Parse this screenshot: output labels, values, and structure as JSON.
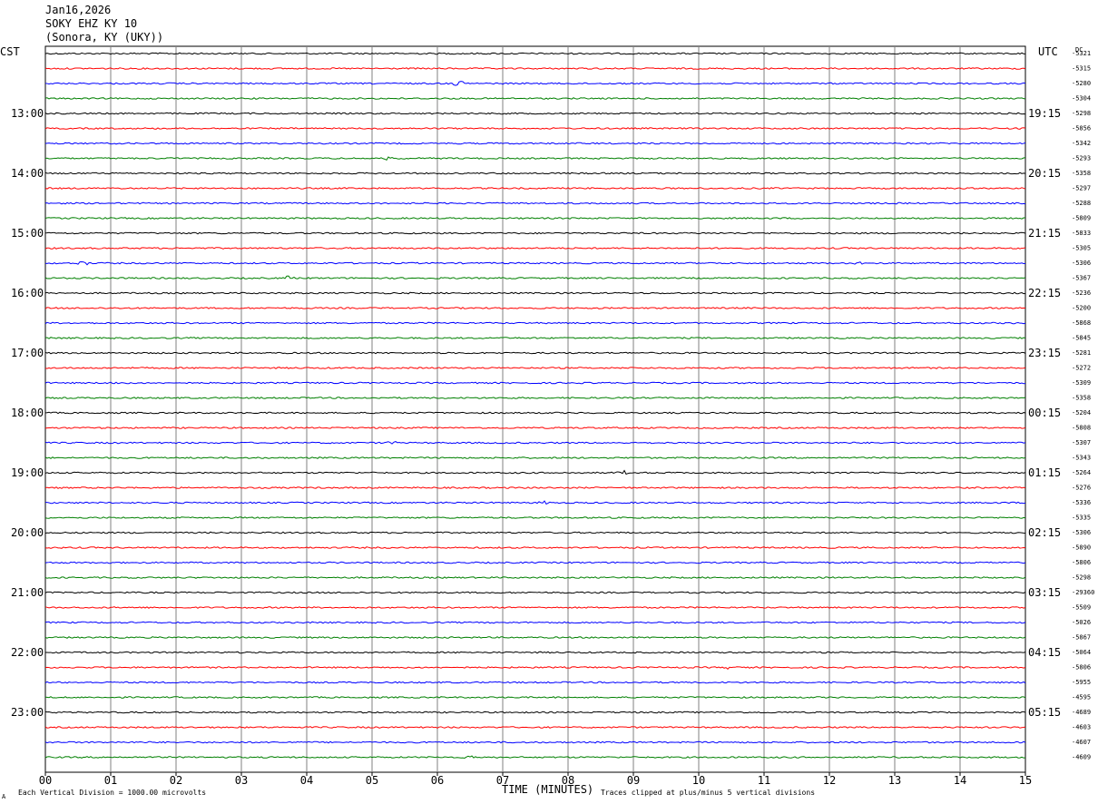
{
  "header": {
    "date": "Jan16,2026",
    "station": "SOKY EHZ KY 10",
    "location": "(Sonora, KY (UKY))"
  },
  "left_axis_label": "CST",
  "right_axis_label": "UTC",
  "dc_label": "DC",
  "footer": {
    "scale_note": "Each Vertical Division = 1000.00 microvolts",
    "x_axis_title": "TIME (MINUTES)",
    "clip_note": "Traces clipped at plus/minus 5 vertical divisions",
    "corner_mark": "A"
  },
  "colors": {
    "trace_cycle": [
      "#000000",
      "#ff0000",
      "#0000ff",
      "#007f00"
    ],
    "grid": "#808080",
    "background": "#ffffff"
  },
  "chart_data": {
    "type": "line",
    "subtype": "helicorder",
    "x_ticks": [
      "00",
      "01",
      "02",
      "03",
      "04",
      "05",
      "06",
      "07",
      "08",
      "09",
      "10",
      "11",
      "12",
      "13",
      "14",
      "15"
    ],
    "xlim": [
      0,
      15
    ],
    "minutes_per_line": 15,
    "n_lines": 48,
    "lines_per_hour": 4,
    "cst_hour_labels": [
      "13:00",
      "14:00",
      "15:00",
      "16:00",
      "17:00",
      "18:00",
      "19:00",
      "20:00",
      "21:00",
      "22:00",
      "23:00"
    ],
    "utc_hour_labels": [
      "19:15",
      "20:15",
      "21:15",
      "22:15",
      "23:15",
      "00:15",
      "01:15",
      "02:15",
      "03:15",
      "04:15",
      "05:15"
    ],
    "first_hour_label_line": 4,
    "dc_offsets": [
      "-5321",
      "-5315",
      "-5280",
      "-5304",
      "-5298",
      "-5856",
      "-5342",
      "-5293",
      "-5358",
      "-5297",
      "-5288",
      "-5809",
      "-5833",
      "-5305",
      "-5306",
      "-5367",
      "-5236",
      "-5200",
      "-5868",
      "-5845",
      "-5281",
      "-5272",
      "-5309",
      "-5358",
      "-5204",
      "-5808",
      "-5307",
      "-5343",
      "-5264",
      "-5276",
      "-5336",
      "-5335",
      "-5306",
      "-5890",
      "-5806",
      "-5298",
      "-29360",
      "-5509",
      "-5026",
      "-5867",
      "-5064",
      "-5806",
      "-5955",
      "-4595",
      "-4689",
      "-4603",
      "-4607",
      "-4609"
    ],
    "events": [
      {
        "line": 2,
        "minute": 6.35,
        "amplitude": 0.9
      },
      {
        "line": 7,
        "minute": 5.25,
        "amplitude": 0.5
      },
      {
        "line": 14,
        "minute": 0.55,
        "amplitude": 1.0
      },
      {
        "line": 14,
        "minute": 12.45,
        "amplitude": 0.5
      },
      {
        "line": 15,
        "minute": 3.7,
        "amplitude": 0.4
      },
      {
        "line": 22,
        "minute": 1.05,
        "amplitude": 0.4
      },
      {
        "line": 26,
        "minute": 5.3,
        "amplitude": 0.5
      },
      {
        "line": 28,
        "minute": 8.85,
        "amplitude": 0.4
      },
      {
        "line": 30,
        "minute": 7.65,
        "amplitude": 0.4
      },
      {
        "line": 34,
        "minute": 0.95,
        "amplitude": 0.3
      },
      {
        "line": 41,
        "minute": 10.5,
        "amplitude": 0.6
      },
      {
        "line": 47,
        "minute": 6.5,
        "amplitude": 0.8
      }
    ]
  }
}
